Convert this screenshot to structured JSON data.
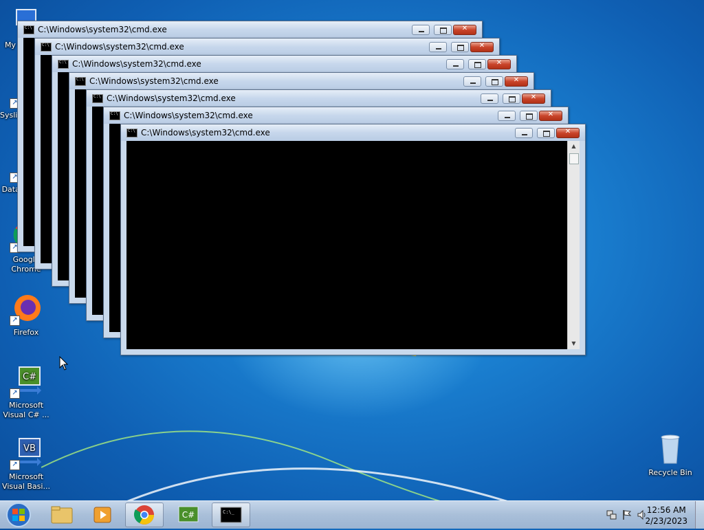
{
  "desktop": {
    "icons": [
      {
        "label": "My Comp..."
      },
      {
        "label": "Syslinternals..."
      },
      {
        "label": "DataVagon..."
      },
      {
        "label": "Google Chrome"
      },
      {
        "label": "Firefox"
      },
      {
        "label": "Microsoft Visual C# ..."
      },
      {
        "label": "Microsoft Visual Basi..."
      },
      {
        "label": "Recycle Bin"
      }
    ]
  },
  "windows": [
    {
      "title": "C:\\Windows\\system32\\cmd.exe"
    },
    {
      "title": "C:\\Windows\\system32\\cmd.exe"
    },
    {
      "title": "C:\\Windows\\system32\\cmd.exe"
    },
    {
      "title": "C:\\Windows\\system32\\cmd.exe"
    },
    {
      "title": "C:\\Windows\\system32\\cmd.exe"
    },
    {
      "title": "C:\\Windows\\system32\\cmd.exe"
    },
    {
      "title": "C:\\Windows\\system32\\cmd.exe"
    }
  ],
  "taskbar": {
    "pinned": [
      "start-orb",
      "explorer",
      "media-player",
      "chrome",
      "visual-csharp",
      "cmd"
    ],
    "clock_time": "12:56 AM",
    "clock_date": "2/23/2023"
  },
  "colors": {
    "desktop_blue": "#1a7fd0",
    "titlebar": "#c7d7ec",
    "close_red": "#c9452b",
    "console_black": "#000000"
  }
}
